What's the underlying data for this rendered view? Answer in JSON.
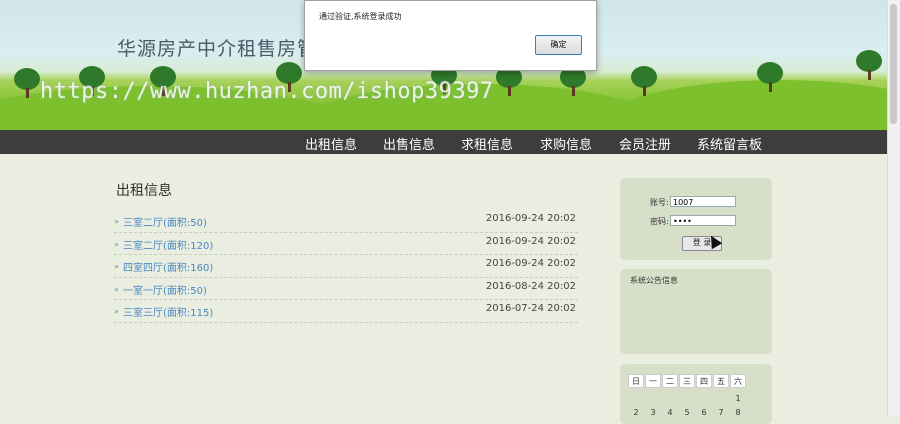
{
  "header": {
    "site_title": "华源房产中介租售房管",
    "watermark": "https://www.huzhan.com/ishop39397"
  },
  "nav": {
    "items": [
      "出租信息",
      "出售信息",
      "求租信息",
      "求购信息",
      "会员注册",
      "系统留言板"
    ]
  },
  "main": {
    "section_title": "出租信息",
    "listings": [
      {
        "title": "三室二厅(面积:50)",
        "date": "2016-09-24 20:02"
      },
      {
        "title": "三室二厅(面积:120)",
        "date": "2016-09-24 20:02"
      },
      {
        "title": "四室四厅(面积:160)",
        "date": "2016-09-24 20:02"
      },
      {
        "title": "一室一厅(面积:50)",
        "date": "2016-08-24 20:02"
      },
      {
        "title": "三室三厅(面积:115)",
        "date": "2016-07-24 20:02"
      }
    ]
  },
  "login": {
    "account_label": "账号:",
    "account_value": "1007",
    "password_label": "密码:",
    "password_value": "••••",
    "login_button": "登 录"
  },
  "notice": {
    "title": "系统公告信息"
  },
  "calendar": {
    "weekdays": [
      "日",
      "一",
      "二",
      "三",
      "四",
      "五",
      "六"
    ],
    "row1": [
      "",
      "",
      "",
      "",
      "",
      "",
      "1"
    ],
    "row2": [
      "2",
      "3",
      "4",
      "5",
      "6",
      "7",
      "8"
    ]
  },
  "dialog": {
    "message": "通过验证,系统登录成功",
    "ok_button": "确定"
  },
  "colors": {
    "nav_bg": "#3d3d3d",
    "page_bg": "#e9eee0",
    "panel_bg": "#d8dfc9",
    "link": "#4a87c2"
  }
}
